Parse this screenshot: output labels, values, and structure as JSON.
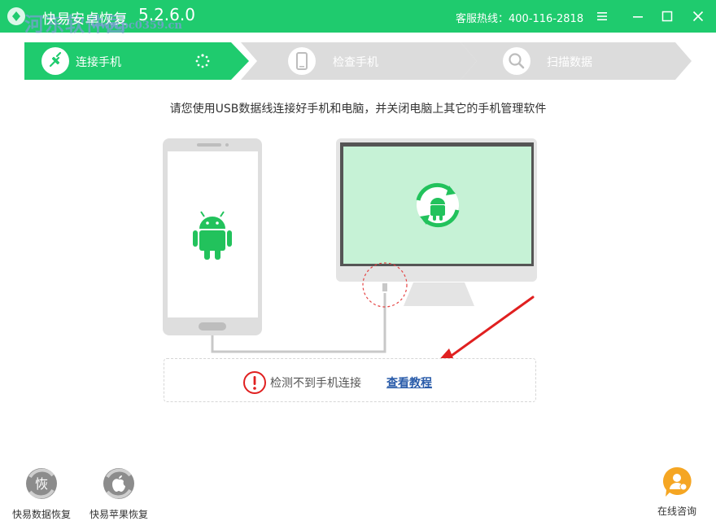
{
  "titlebar": {
    "title": "快易安卓恢复",
    "version": "5.2.6.0",
    "watermark": "河东软件园",
    "watermark_url": "www.pc0359.cn",
    "hotline": "客服热线：400-116-2818",
    "bg_color": "#1fcb6e"
  },
  "steps": [
    {
      "label": "连接手机",
      "icon": "plug-icon",
      "state": "active"
    },
    {
      "label": "检查手机",
      "icon": "phone-icon",
      "state": "inactive"
    },
    {
      "label": "扫描数据",
      "icon": "magnifier-icon",
      "state": "inactive"
    }
  ],
  "instruction": "请您使用USB数据线连接好手机和电脑，并关闭电脑上其它的手机管理软件",
  "status": {
    "error_text": "检测不到手机连接",
    "tutorial_link": "查看教程",
    "error_color": "#e02020"
  },
  "bottom_tools": [
    {
      "label": "快易数据恢复",
      "badge": "恢",
      "icon": "data-recovery-icon"
    },
    {
      "label": "快易苹果恢复",
      "badge": "",
      "icon": "apple-recovery-icon"
    }
  ],
  "consult": {
    "label": "在线咨询",
    "icon": "consult-icon",
    "color": "#f5a623"
  },
  "accent": "#1fcb6e"
}
